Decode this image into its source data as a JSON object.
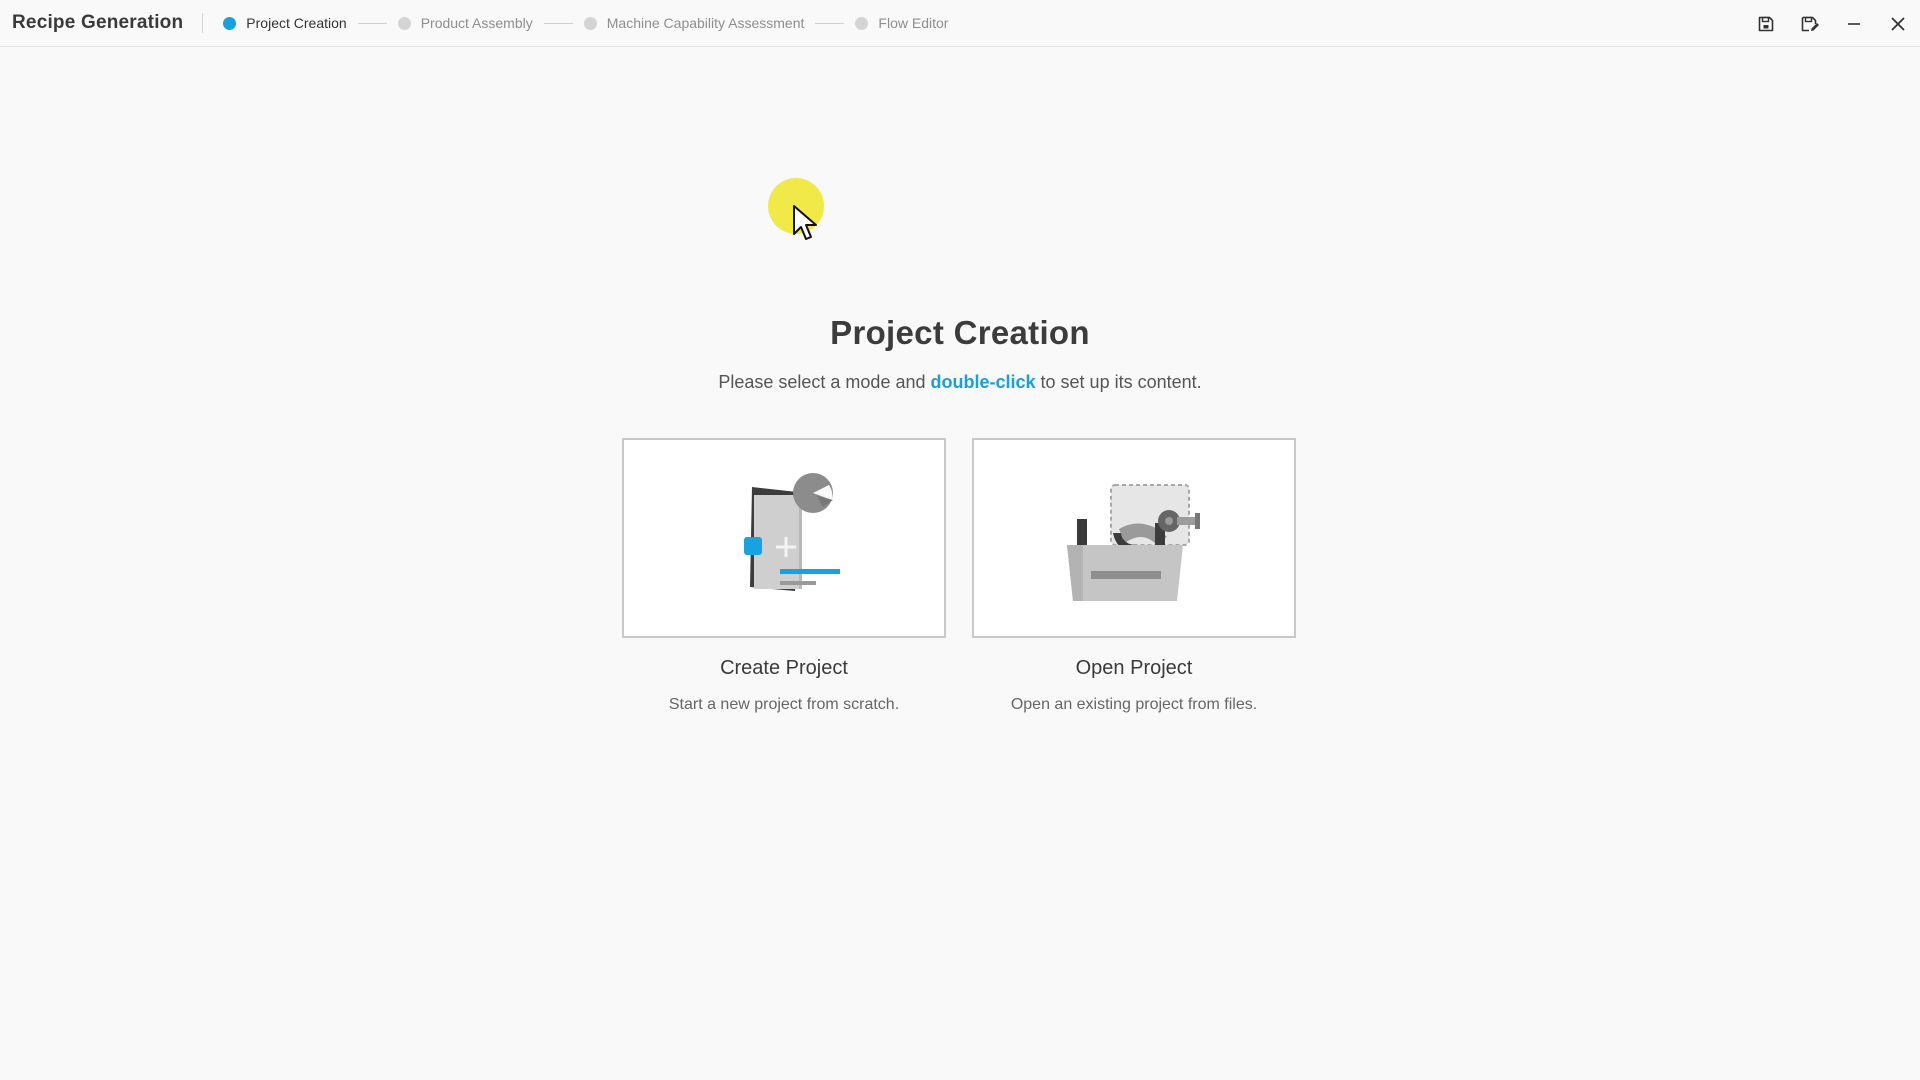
{
  "app": {
    "title": "Recipe Generation"
  },
  "steps": [
    {
      "label": "Project Creation",
      "active": true
    },
    {
      "label": "Product Assembly",
      "active": false
    },
    {
      "label": "Machine Capability Assessment",
      "active": false
    },
    {
      "label": "Flow Editor",
      "active": false
    }
  ],
  "window_controls": {
    "icons": [
      "save-icon",
      "save-as-icon",
      "minimize-icon",
      "close-icon"
    ]
  },
  "main": {
    "title": "Project Creation",
    "instruction_pre": "Please select a mode and ",
    "instruction_highlight": "double-click",
    "instruction_post": " to set up its content."
  },
  "cards": [
    {
      "title": "Create Project",
      "description": "Start a new project from scratch.",
      "icon": "new-document-icon"
    },
    {
      "title": "Open Project",
      "description": "Open an existing project from files.",
      "icon": "open-folder-icon"
    }
  ],
  "colors": {
    "accent": "#1aa0dd",
    "background": "#f9f9f9",
    "step_inactive": "#d4d4d4",
    "cursor_highlight": "#f0e628"
  }
}
